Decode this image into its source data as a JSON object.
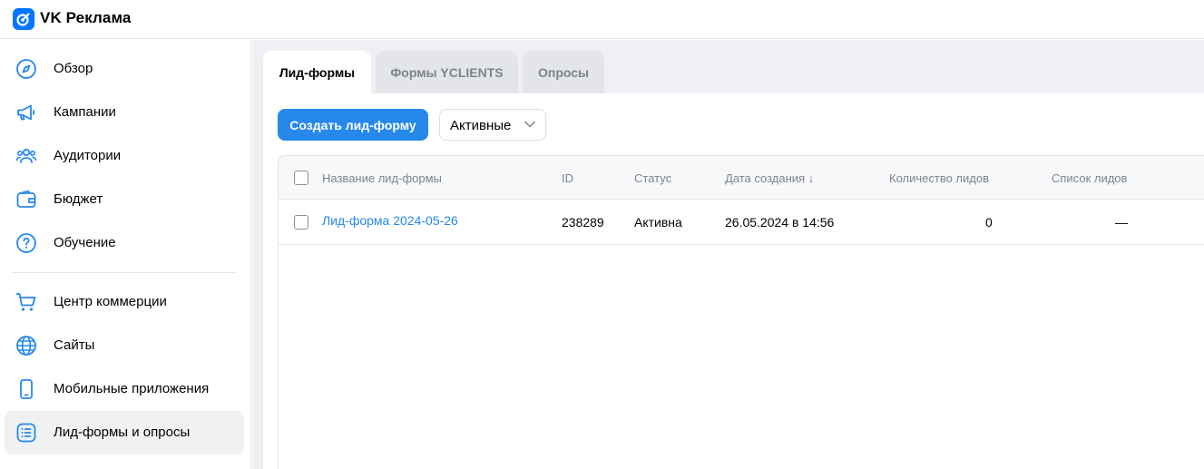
{
  "app": {
    "brand": "VK Реклама"
  },
  "sidebar": {
    "items": [
      {
        "label": "Обзор",
        "icon": "compass-icon"
      },
      {
        "label": "Кампании",
        "icon": "megaphone-icon"
      },
      {
        "label": "Аудитории",
        "icon": "users-icon"
      },
      {
        "label": "Бюджет",
        "icon": "wallet-icon"
      },
      {
        "label": "Обучение",
        "icon": "question-icon"
      },
      {
        "label": "Центр коммерции",
        "icon": "cart-icon"
      },
      {
        "label": "Сайты",
        "icon": "globe-icon"
      },
      {
        "label": "Мобильные приложения",
        "icon": "smartphone-icon"
      },
      {
        "label": "Лид-формы и опросы",
        "icon": "list-icon",
        "active": true
      }
    ]
  },
  "tabs": [
    {
      "label": "Лид-формы",
      "active": true
    },
    {
      "label": "Формы YCLIENTS"
    },
    {
      "label": "Опросы"
    }
  ],
  "toolbar": {
    "create_label": "Создать лид-форму",
    "filter_value": "Активные"
  },
  "table": {
    "headers": {
      "name": "Название лид-формы",
      "id": "ID",
      "status": "Статус",
      "created": "Дата создания ↓",
      "leads_count": "Количество лидов",
      "leads_list": "Список лидов"
    },
    "rows": [
      {
        "name": "Лид-форма 2024-05-26",
        "id": "238289",
        "status": "Активна",
        "created": "26.05.2024 в 14:56",
        "leads_count": "0",
        "leads_list": "—"
      }
    ]
  },
  "colors": {
    "accent": "#2688eb",
    "brand": "#0077ff",
    "background": "#eef0f3"
  }
}
